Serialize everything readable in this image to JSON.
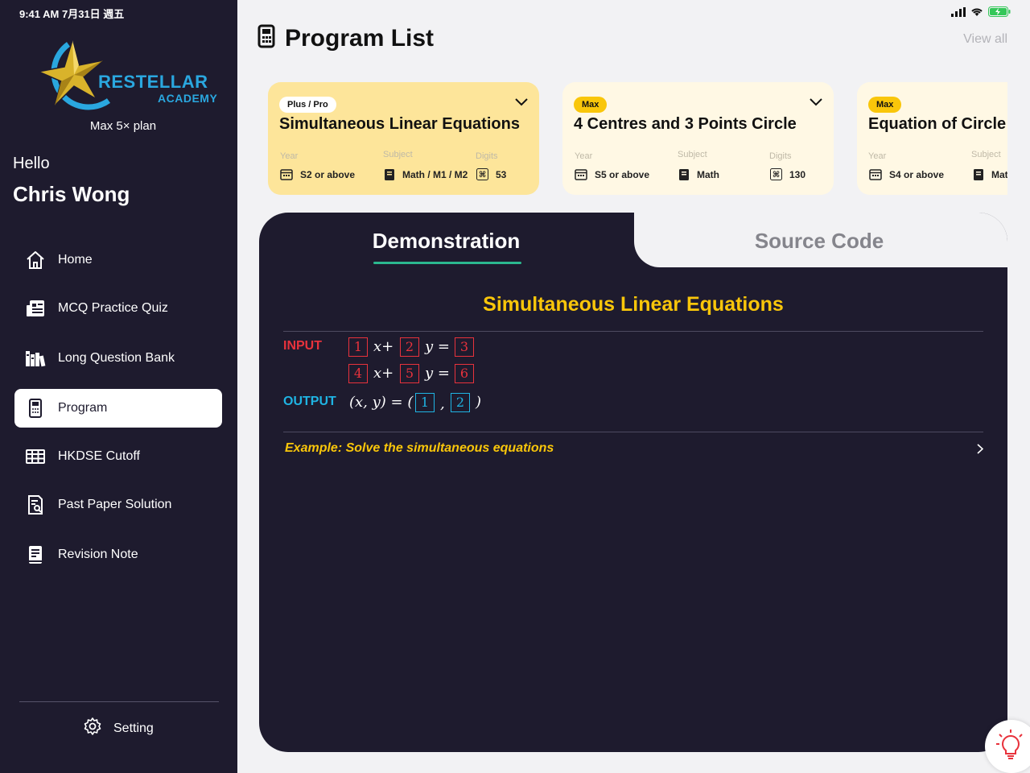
{
  "status": {
    "time": "9:41 AM  7月31日 週五"
  },
  "brand": {
    "name": "RESTELLAR",
    "sub": "ACADEMY",
    "plan": "Max 5× plan"
  },
  "user": {
    "greeting": "Hello",
    "name": "Chris Wong"
  },
  "sidebar": {
    "items": [
      {
        "label": "Home",
        "icon": "home-icon"
      },
      {
        "label": "MCQ Practice Quiz",
        "icon": "quiz-icon"
      },
      {
        "label": "Long Question Bank",
        "icon": "books-icon"
      },
      {
        "label": "Program",
        "icon": "calculator-icon",
        "active": true
      },
      {
        "label": "HKDSE Cutoff",
        "icon": "table-icon"
      },
      {
        "label": "Past Paper Solution",
        "icon": "document-search-icon"
      },
      {
        "label": "Revision Note",
        "icon": "note-book-icon"
      }
    ],
    "setting_label": "Setting"
  },
  "header": {
    "title": "Program List",
    "view_all": "View all"
  },
  "cards": [
    {
      "badge": "Plus / Pro",
      "title": "Simultaneous Linear Equations",
      "year_label": "Year",
      "year": "S2 or above",
      "subject_label": "Subject",
      "subject": "Math / M1 / M2",
      "digits_label": "Digits",
      "digits": "53"
    },
    {
      "badge": "Max",
      "title": "4 Centres and 3 Points Circle",
      "year_label": "Year",
      "year": "S5 or above",
      "subject_label": "Subject",
      "subject": "Math",
      "digits_label": "Digits",
      "digits": "130"
    },
    {
      "badge": "Max",
      "title": "Equation of Circle",
      "year_label": "Year",
      "year": "S4 or above",
      "subject_label": "Subject",
      "subject": "Math"
    }
  ],
  "tabs": {
    "demo": "Demonstration",
    "source": "Source Code"
  },
  "demo": {
    "title": "Simultaneous Linear Equations",
    "input_label": "INPUT",
    "output_label": "OUTPUT",
    "eq1": [
      "1",
      "2",
      "3"
    ],
    "eq2": [
      "4",
      "5",
      "6"
    ],
    "out": [
      "1",
      "2"
    ],
    "x_plus": "x+",
    "y_eq": "y =",
    "out_prefix": "(x, y) = (",
    "out_comma": ",",
    "out_suffix": ")",
    "example": "Example: Solve the simultaneous equations"
  },
  "colors": {
    "sidebar_bg": "#1e1b2e",
    "accent_yellow": "#f9c60a",
    "input_red": "#e8323c",
    "output_blue": "#1fb4e3",
    "tab_green": "#2bb88f",
    "card_active": "#fde59a",
    "card": "#fff8e4"
  }
}
